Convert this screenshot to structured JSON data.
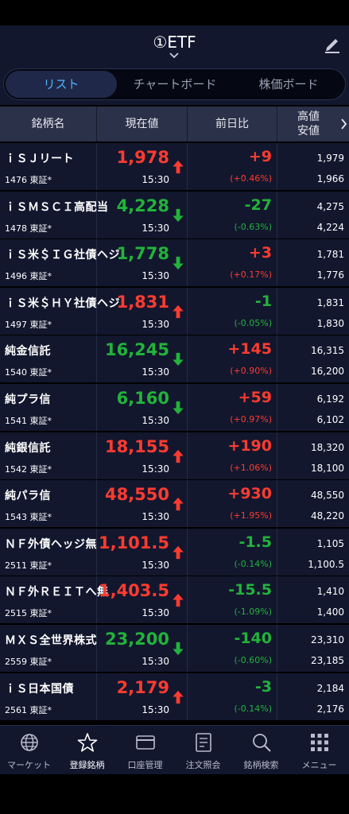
{
  "header": {
    "title": "①ETF"
  },
  "segments": [
    "リスト",
    "チャートボード",
    "株価ボード"
  ],
  "columns": {
    "name": "銘柄名",
    "price": "現在値",
    "change": "前日比",
    "hl_top": "高値",
    "hl_bottom": "安値"
  },
  "colors": {
    "up": "#ff3b30",
    "down": "#22b33a",
    "accent": "#4fb3ff"
  },
  "rows": [
    {
      "name": "ｉＳＪリート",
      "code": "1476 東証*",
      "price": "1,978",
      "dir": "up",
      "time": "15:30",
      "change": "+9",
      "pct": "(+0.46%)",
      "chg_dir": "up",
      "high": "1,979",
      "low": "1,966"
    },
    {
      "name": "ｉＳＭＳＣＩ高配当",
      "code": "1478 東証*",
      "price": "4,228",
      "dir": "down",
      "time": "15:30",
      "change": "-27",
      "pct": "(-0.63%)",
      "chg_dir": "down",
      "high": "4,275",
      "low": "4,224"
    },
    {
      "name": "ｉＳ米＄ＩＧ社債ヘジ",
      "code": "1496 東証*",
      "price": "1,778",
      "dir": "down",
      "time": "15:30",
      "change": "+3",
      "pct": "(+0.17%)",
      "chg_dir": "up",
      "high": "1,781",
      "low": "1,776"
    },
    {
      "name": "ｉＳ米＄ＨＹ社債ヘジ",
      "code": "1497 東証*",
      "price": "1,831",
      "dir": "up",
      "time": "15:30",
      "change": "-1",
      "pct": "(-0.05%)",
      "chg_dir": "down",
      "high": "1,831",
      "low": "1,830"
    },
    {
      "name": "純金信託",
      "code": "1540 東証*",
      "price": "16,245",
      "dir": "down",
      "time": "15:30",
      "change": "+145",
      "pct": "(+0.90%)",
      "chg_dir": "up",
      "high": "16,315",
      "low": "16,200"
    },
    {
      "name": "純プラ信",
      "code": "1541 東証*",
      "price": "6,160",
      "dir": "down",
      "time": "15:30",
      "change": "+59",
      "pct": "(+0.97%)",
      "chg_dir": "up",
      "high": "6,192",
      "low": "6,102"
    },
    {
      "name": "純銀信託",
      "code": "1542 東証*",
      "price": "18,155",
      "dir": "up",
      "time": "15:30",
      "change": "+190",
      "pct": "(+1.06%)",
      "chg_dir": "up",
      "high": "18,320",
      "low": "18,100"
    },
    {
      "name": "純パラ信",
      "code": "1543 東証*",
      "price": "48,550",
      "dir": "up",
      "time": "15:30",
      "change": "+930",
      "pct": "(+1.95%)",
      "chg_dir": "up",
      "high": "48,550",
      "low": "48,220"
    },
    {
      "name": "ＮＦ外債ヘッジ無",
      "code": "2511 東証*",
      "price": "1,101.5",
      "dir": "up",
      "time": "15:30",
      "change": "-1.5",
      "pct": "(-0.14%)",
      "chg_dir": "down",
      "high": "1,105",
      "low": "1,100.5"
    },
    {
      "name": "ＮＦ外ＲＥＩＴへ無",
      "code": "2515 東証*",
      "price": "1,403.5",
      "dir": "up",
      "time": "15:30",
      "change": "-15.5",
      "pct": "(-1.09%)",
      "chg_dir": "down",
      "high": "1,410",
      "low": "1,400"
    },
    {
      "name": "ＭＸＳ全世界株式",
      "code": "2559 東証*",
      "price": "23,200",
      "dir": "down",
      "time": "15:30",
      "change": "-140",
      "pct": "(-0.60%)",
      "chg_dir": "down",
      "high": "23,310",
      "low": "23,185"
    },
    {
      "name": "ｉＳ日本国債",
      "code": "2561 東証*",
      "price": "2,179",
      "dir": "up",
      "time": "15:30",
      "change": "-3",
      "pct": "(-0.14%)",
      "chg_dir": "down",
      "high": "2,184",
      "low": "2,176"
    }
  ],
  "tabs": [
    {
      "label": "マーケット",
      "icon": "globe-icon"
    },
    {
      "label": "登録銘柄",
      "icon": "star-icon"
    },
    {
      "label": "口座管理",
      "icon": "card-icon"
    },
    {
      "label": "注文照会",
      "icon": "document-icon"
    },
    {
      "label": "銘柄検索",
      "icon": "search-icon"
    },
    {
      "label": "メニュー",
      "icon": "grid-menu-icon"
    }
  ]
}
